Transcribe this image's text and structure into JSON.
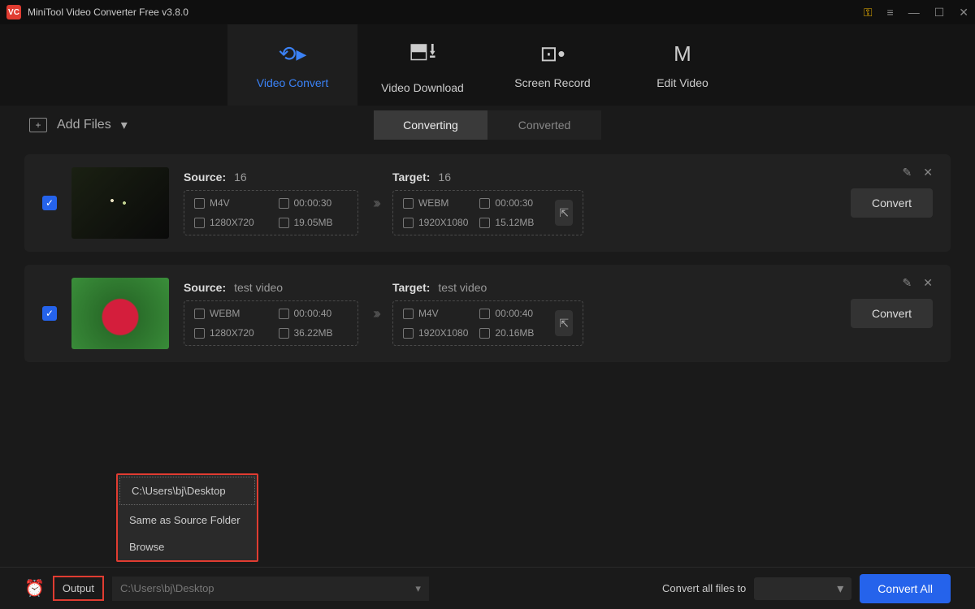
{
  "titlebar": {
    "title": "MiniTool Video Converter Free v3.8.0"
  },
  "topnav": {
    "items": [
      {
        "label": "Video Convert"
      },
      {
        "label": "Video Download"
      },
      {
        "label": "Screen Record"
      },
      {
        "label": "Edit Video"
      }
    ]
  },
  "subbar": {
    "add_files": "Add Files",
    "tabs": [
      {
        "label": "Converting"
      },
      {
        "label": "Converted"
      }
    ]
  },
  "files": [
    {
      "source_label": "Source:",
      "source_name": "16",
      "source_format": "M4V",
      "source_duration": "00:00:30",
      "source_res": "1280X720",
      "source_size": "19.05MB",
      "target_label": "Target:",
      "target_name": "16",
      "target_format": "WEBM",
      "target_duration": "00:00:30",
      "target_res": "1920X1080",
      "target_size": "15.12MB",
      "convert": "Convert"
    },
    {
      "source_label": "Source:",
      "source_name": "test video",
      "source_format": "WEBM",
      "source_duration": "00:00:40",
      "source_res": "1280X720",
      "source_size": "36.22MB",
      "target_label": "Target:",
      "target_name": "test video",
      "target_format": "M4V",
      "target_duration": "00:00:40",
      "target_res": "1920X1080",
      "target_size": "20.16MB",
      "convert": "Convert"
    }
  ],
  "dropdown": {
    "items": [
      "C:\\Users\\bj\\Desktop",
      "Same as Source Folder",
      "Browse"
    ]
  },
  "bottombar": {
    "output_label": "Output",
    "output_path": "C:\\Users\\bj\\Desktop",
    "convert_to_label": "Convert all files to",
    "convert_all": "Convert All"
  }
}
